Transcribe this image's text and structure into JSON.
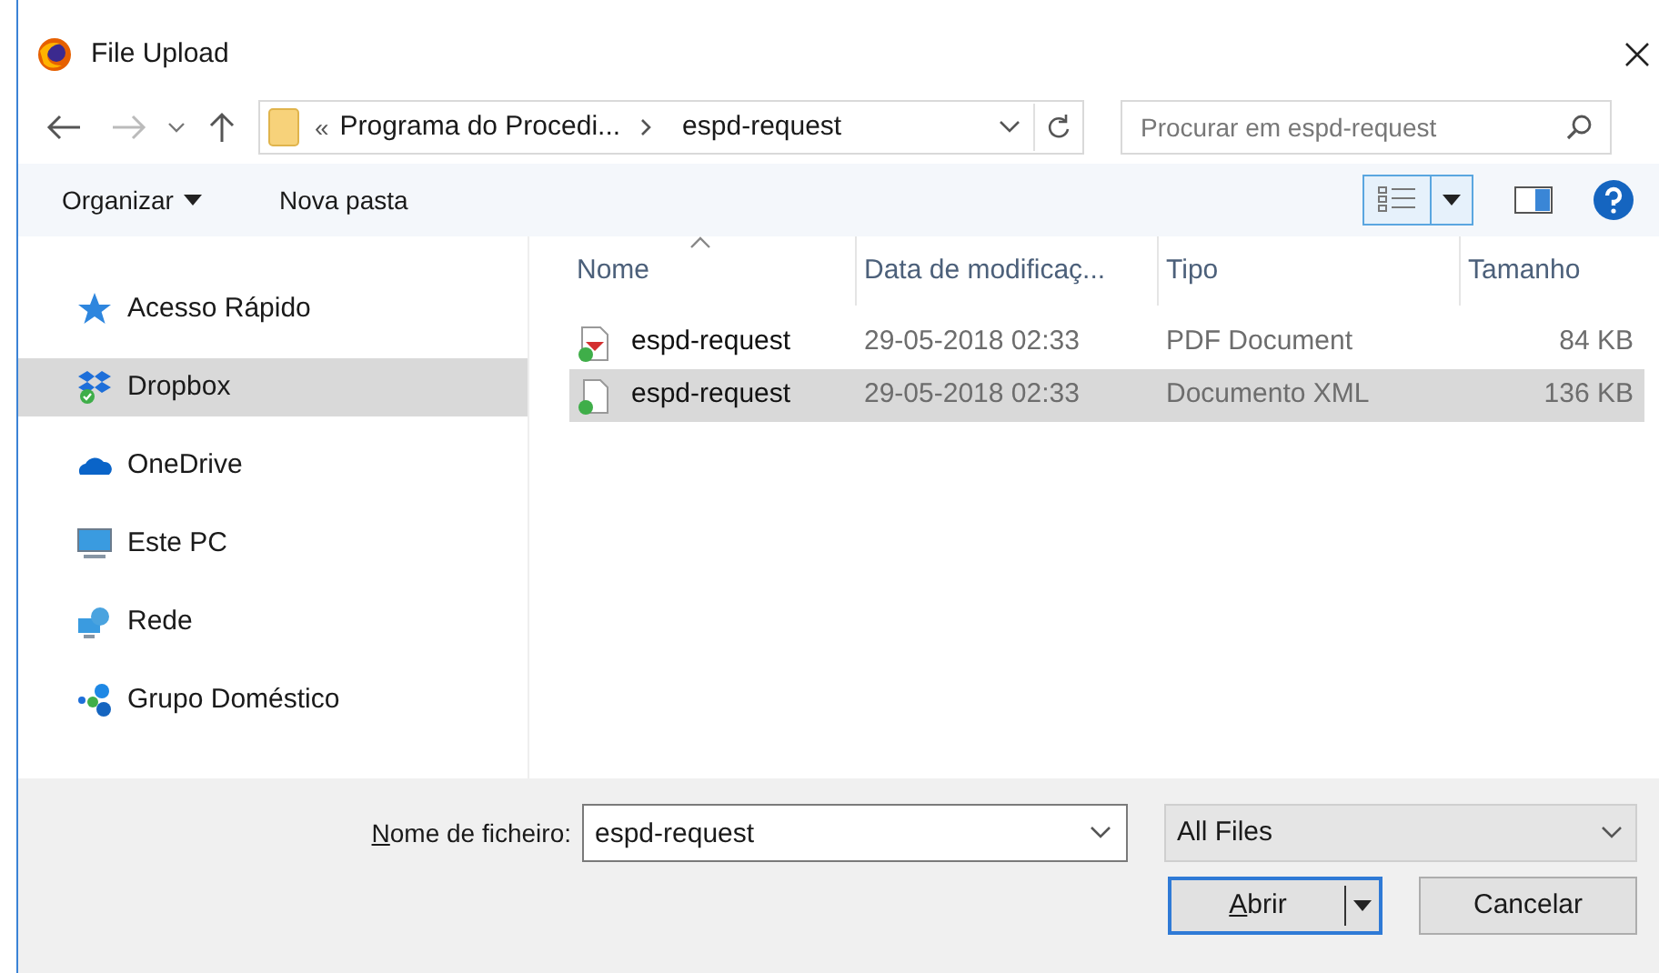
{
  "window": {
    "title": "File Upload"
  },
  "address": {
    "overflow": "«",
    "crumbs": [
      "Programa do Procedi...",
      "espd-request"
    ]
  },
  "search": {
    "placeholder": "Procurar em espd-request"
  },
  "toolbar": {
    "organize": "Organizar",
    "new_folder": "Nova pasta"
  },
  "sidebar": {
    "items": [
      {
        "kind": "star",
        "label": "Acesso Rápido",
        "selected": false
      },
      {
        "kind": "dropbox",
        "label": "Dropbox",
        "selected": true
      },
      {
        "kind": "cloud",
        "label": "OneDrive",
        "selected": false
      },
      {
        "kind": "pc",
        "label": "Este PC",
        "selected": false
      },
      {
        "kind": "network",
        "label": "Rede",
        "selected": false
      },
      {
        "kind": "homegroup",
        "label": "Grupo Doméstico",
        "selected": false
      }
    ]
  },
  "table": {
    "columns": [
      "Nome",
      "Data de modificaç...",
      "Tipo",
      "Tamanho"
    ],
    "rows": [
      {
        "kind": "pdf",
        "name": "espd-request",
        "date": "29-05-2018 02:33",
        "type": "PDF Document",
        "size": "84 KB",
        "selected": false
      },
      {
        "kind": "xml",
        "name": "espd-request",
        "date": "29-05-2018 02:33",
        "type": "Documento XML",
        "size": "136 KB",
        "selected": true
      }
    ]
  },
  "filename": {
    "label": "Nome de ficheiro:",
    "value": "espd-request"
  },
  "filter": {
    "value": "All Files"
  },
  "buttons": {
    "open": "Abrir",
    "cancel": "Cancelar"
  }
}
